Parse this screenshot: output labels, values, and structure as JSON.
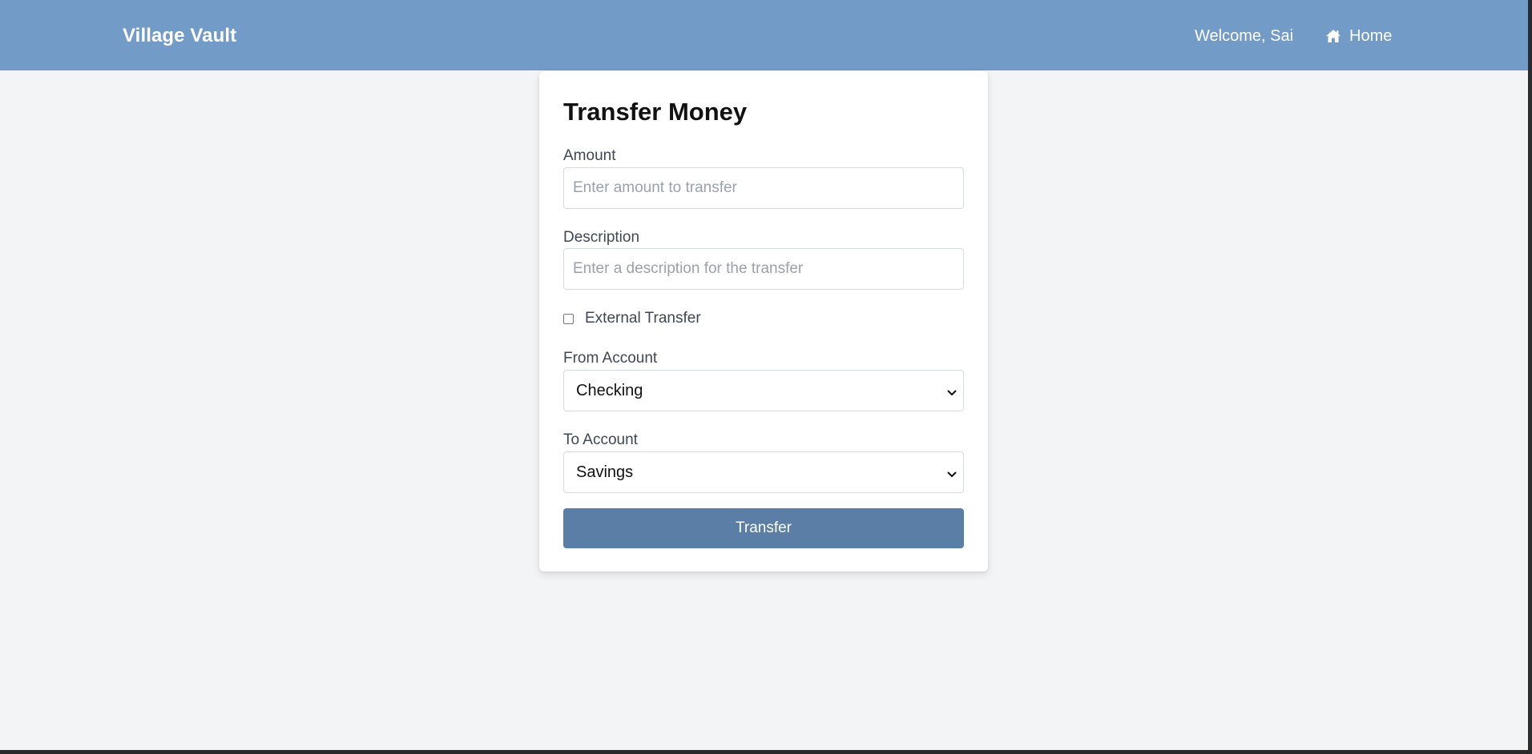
{
  "app": {
    "brand": "Village Vault"
  },
  "nav": {
    "welcome": "Welcome, Sai",
    "home_label": "Home",
    "home_icon": "home-icon"
  },
  "form": {
    "title": "Transfer Money",
    "amount": {
      "label": "Amount",
      "value": "",
      "placeholder": "Enter amount to transfer"
    },
    "description": {
      "label": "Description",
      "value": "",
      "placeholder": "Enter a description for the transfer"
    },
    "external_transfer": {
      "label": "External Transfer",
      "checked": false
    },
    "from_account": {
      "label": "From Account",
      "selected": "Checking"
    },
    "to_account": {
      "label": "To Account",
      "selected": "Savings"
    },
    "submit_label": "Transfer"
  },
  "colors": {
    "navbar": "#739bc8",
    "page_background": "#f3f4f6",
    "button": "#5a7ea5"
  }
}
